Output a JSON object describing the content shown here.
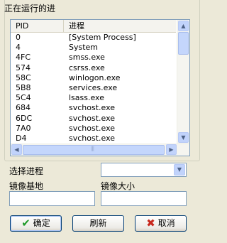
{
  "group": {
    "title": "正在运行的进"
  },
  "process_list": {
    "columns": [
      "PID",
      "进程"
    ],
    "rows": [
      [
        "0",
        "[System Process]"
      ],
      [
        "4",
        "System"
      ],
      [
        "4FC",
        "smss.exe"
      ],
      [
        "574",
        "csrss.exe"
      ],
      [
        "58C",
        "winlogon.exe"
      ],
      [
        "5B8",
        "services.exe"
      ],
      [
        "5C4",
        "lsass.exe"
      ],
      [
        "684",
        "svchost.exe"
      ],
      [
        "6DC",
        "svchost.exe"
      ],
      [
        "7A0",
        "svchost.exe"
      ],
      [
        "D4",
        "svchost.exe"
      ]
    ]
  },
  "select_process": {
    "label": "选择进程",
    "value": ""
  },
  "image_base": {
    "label": "镜像基地",
    "value": ""
  },
  "image_size": {
    "label": "镜像大小",
    "value": ""
  },
  "buttons": {
    "ok": "确定",
    "refresh": "刷新",
    "cancel": "取消"
  },
  "icons": {
    "ok": "check-icon",
    "cancel": "x-icon"
  },
  "colors": {
    "ok_icon": "#1f9a2a",
    "cancel_icon": "#c8281e",
    "border": "#7f9db9"
  }
}
